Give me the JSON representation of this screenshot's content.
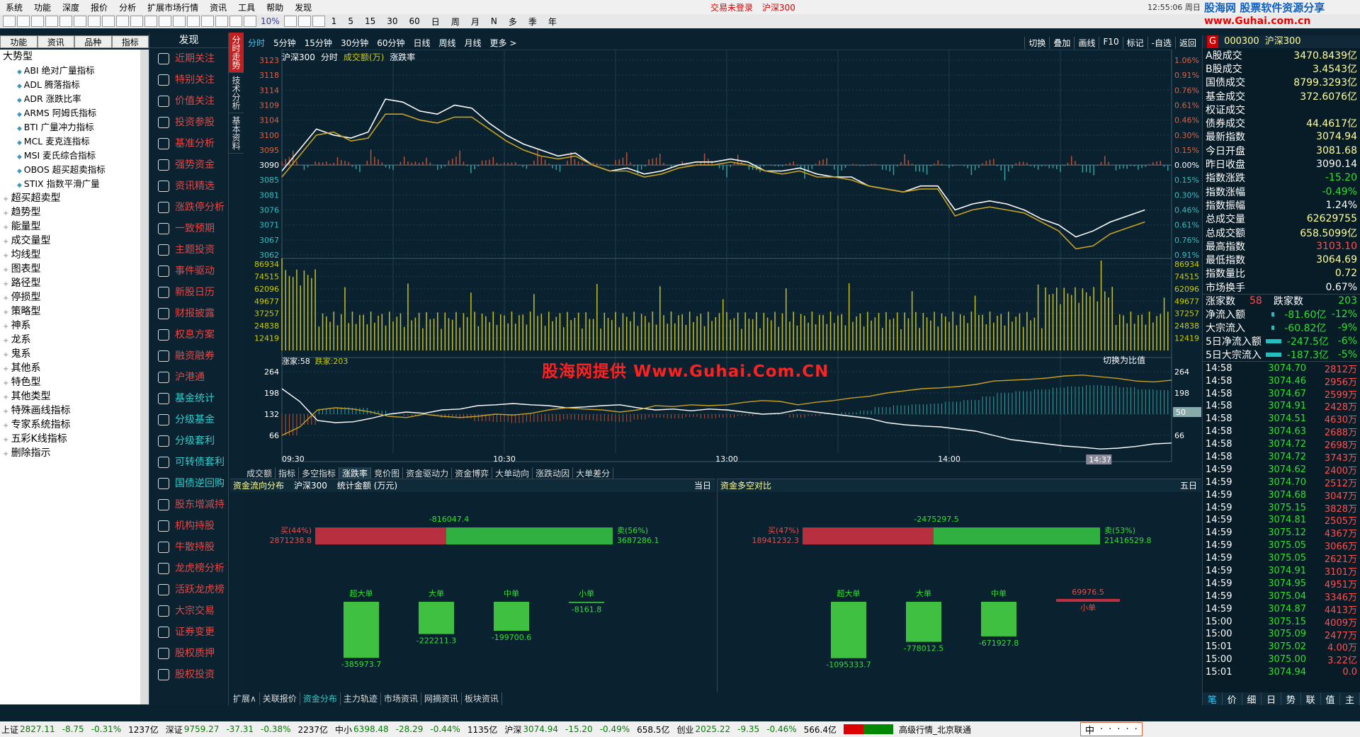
{
  "menu": {
    "items": [
      "系统",
      "功能",
      "深度",
      "报价",
      "分析",
      "扩展市场行情",
      "资讯",
      "工具",
      "帮助",
      "发现"
    ],
    "status": "交易未登录",
    "index": "沪深300",
    "clock": "12:55:06 周日",
    "watermark_top": "股海网 股票软件资源分享",
    "watermark_url": "www.Guhai.com.cn"
  },
  "toolbar": {
    "zoom": "10%",
    "periods": [
      "1",
      "5",
      "15",
      "30",
      "60",
      "日",
      "周",
      "月",
      "N",
      "多",
      "季",
      "年"
    ]
  },
  "left_tabs": [
    "功能",
    "资讯",
    "品种",
    "指标"
  ],
  "tree": {
    "root": "大势型",
    "children": [
      "ABI 绝对广量指标",
      "ADL 腾落指标",
      "ADR 涨跌比率",
      "ARMS 阿姆氏指标",
      "BTI 广量冲力指标",
      "MCL 麦克连指标",
      "MSI 麦氏综合指标",
      "OBOS 超买超卖指标",
      "STIX 指数平滑广量"
    ],
    "groups": [
      "超买超卖型",
      "趋势型",
      "能量型",
      "成交量型",
      "均线型",
      "图表型",
      "路径型",
      "停损型",
      "策略型",
      "神系",
      "龙系",
      "鬼系",
      "其他系",
      "特色型",
      "其他类型",
      "特殊画线指标",
      "专家系统指标",
      "五彩K线指标",
      "删除指示"
    ]
  },
  "discover": {
    "title": "发现",
    "items": [
      "近期关注",
      "特别关注",
      "价值关注",
      "投资参股",
      "基准分析",
      "强势资金",
      "资讯精选",
      "涨跌停分析",
      "一致预期",
      "主题投资",
      "事件驱动",
      "新股日历",
      "财报披露",
      "权息方案",
      "融资融券",
      "沪港通",
      "基金统计",
      "分级基金",
      "分级套利",
      "可转债套利",
      "国债逆回购",
      "股东增减持",
      "机构持股",
      "牛散持股",
      "龙虎榜分析",
      "活跃龙虎榜",
      "大宗交易",
      "证券变更",
      "股权质押",
      "股权投资"
    ]
  },
  "side_tabs": [
    "分时走势",
    "技术分析",
    "基本资料"
  ],
  "period_bar": {
    "items": [
      "分时",
      "5分钟",
      "15分钟",
      "30分钟",
      "60分钟",
      "日线",
      "周线",
      "月线",
      "更多 >"
    ],
    "right": [
      "切换",
      "叠加",
      "画线",
      "F10",
      "标记",
      "-自选",
      "返回"
    ]
  },
  "chart_labels": {
    "name": "沪深300",
    "mode": "分时",
    "vol_label": "成交额(万)",
    "ratio": "涨跌率",
    "up_count": "涨家:58",
    "down_count": "跌家:203",
    "switch": "切换为比值"
  },
  "watermark": "股海网提供 Www.Guhai.Com.CN",
  "chart_data": {
    "type": "line",
    "x_ticks": [
      "09:30",
      "10:30",
      "13:00",
      "14:00"
    ],
    "cursor_time": "14:37",
    "price_ticks": [
      "3123",
      "3118",
      "3114",
      "3109",
      "3104",
      "3100",
      "3095",
      "3090",
      "3085",
      "3081",
      "3076",
      "3071",
      "3067",
      "3062"
    ],
    "pct_ticks": [
      "1.06%",
      "0.91%",
      "0.76%",
      "0.61%",
      "0.46%",
      "0.30%",
      "0.15%",
      "0.00%",
      "0.15%",
      "0.30%",
      "0.46%",
      "0.61%",
      "0.76%",
      "0.91%"
    ],
    "vol_ticks": [
      "86934",
      "74515",
      "62096",
      "49677",
      "37257",
      "24838",
      "12419"
    ],
    "ratio_ticks": [
      "264",
      "198",
      "132",
      "66"
    ],
    "ratio_marker": "50",
    "prev_close": 3090.14,
    "price_range": [
      3060,
      3125
    ],
    "series": [
      {
        "name": "沪深300",
        "values": [
          3088,
          3095,
          3102,
          3100,
          3099,
          3101,
          3112,
          3111,
          3108,
          3107,
          3110,
          3109,
          3104,
          3100,
          3097,
          3095,
          3093,
          3094,
          3090,
          3088,
          3089,
          3087,
          3088,
          3090,
          3091,
          3091,
          3092,
          3091,
          3088,
          3088,
          3089,
          3087,
          3086,
          3086,
          3083,
          3082,
          3081,
          3083,
          3083,
          3075,
          3077,
          3078,
          3077,
          3075,
          3072,
          3070,
          3066,
          3068,
          3071,
          3073,
          3075
        ]
      },
      {
        "values": [
          3086,
          3093,
          3100,
          3101,
          3098,
          3099,
          3107,
          3107,
          3105,
          3104,
          3106,
          3106,
          3102,
          3098,
          3095,
          3093,
          3092,
          3093,
          3090,
          3088,
          3088,
          3086,
          3087,
          3089,
          3090,
          3090,
          3091,
          3090,
          3088,
          3087,
          3088,
          3086,
          3086,
          3085,
          3083,
          3082,
          3081,
          3082,
          3082,
          3073,
          3075,
          3076,
          3075,
          3074,
          3071,
          3068,
          3062,
          3063,
          3067,
          3069,
          3071
        ]
      }
    ],
    "ratio_series": [
      {
        "name": "涨家",
        "values": [
          90,
          120,
          165,
          170,
          168,
          160,
          150,
          145,
          148,
          140,
          138,
          130,
          128,
          125,
          128,
          130,
          135,
          133,
          130,
          128,
          135,
          140,
          138,
          142,
          138,
          140,
          145,
          150,
          148,
          140,
          145,
          150,
          155,
          160,
          170,
          175,
          178,
          180,
          185,
          190,
          200,
          210,
          215,
          220,
          225,
          228,
          232,
          230,
          226,
          220,
          218
        ]
      },
      {
        "name": "跌家",
        "values": [
          200,
          180,
          140,
          135,
          138,
          145,
          155,
          158,
          150,
          155,
          158,
          155,
          150,
          152,
          148,
          140,
          135,
          138,
          140,
          145,
          140,
          130,
          132,
          128,
          130,
          128,
          122,
          118,
          120,
          128,
          122,
          118,
          112,
          108,
          100,
          95,
          90,
          88,
          85,
          80,
          72,
          70,
          68,
          65,
          60,
          58,
          62,
          66,
          72,
          74,
          70
        ]
      }
    ]
  },
  "bottom_tabs": [
    "成交额",
    "指标",
    "多空指标",
    "涨跌率",
    "竞价图",
    "资金驱动力",
    "资金博弈",
    "大单动向",
    "涨跌动因",
    "大单差分"
  ],
  "flow_panel": {
    "title": "资金流向分布",
    "index": "沪深300",
    "unit": "统计金额 (万元)",
    "period": "当日",
    "buy_label": "买(44%)",
    "buy_value": "2871238.8",
    "net": "-816047.4",
    "sell_label": "卖(56%)",
    "sell_value": "3687286.1",
    "bars": [
      {
        "name": "超大单",
        "value": "-385973.7"
      },
      {
        "name": "大单",
        "value": "-222211.3"
      },
      {
        "name": "中单",
        "value": "-199700.6"
      },
      {
        "name": "小单",
        "value": "-8161.8"
      }
    ]
  },
  "multi_panel": {
    "title": "资金多空对比",
    "period": "五日",
    "buy_label": "买(47%)",
    "buy_value": "18941232.3",
    "net": "-2475297.5",
    "sell_label": "卖(53%)",
    "sell_value": "21416529.8",
    "bars": [
      {
        "name": "超大单",
        "value": "-1095333.7"
      },
      {
        "name": "大单",
        "value": "-778012.5"
      },
      {
        "name": "中单",
        "value": "-671927.8"
      },
      {
        "name": "小单",
        "value": "69976.5"
      }
    ]
  },
  "bottom_tabs2": [
    "扩展∧",
    "关联报价",
    "资金分布",
    "主力轨迹",
    "市场资讯",
    "网摘资讯",
    "板块资讯"
  ],
  "right": {
    "code": "000300",
    "name": "沪深300",
    "stats": [
      {
        "k": "A股成交",
        "v": "3470.8439亿"
      },
      {
        "k": "B股成交",
        "v": "3.4543亿"
      },
      {
        "k": "国债成交",
        "v": "8799.3293亿"
      },
      {
        "k": "基金成交",
        "v": "372.6076亿"
      },
      {
        "k": "权证成交",
        "v": ""
      },
      {
        "k": "债券成交",
        "v": "44.4617亿"
      },
      {
        "k": "最新指数",
        "v": "3074.94"
      },
      {
        "k": "今日开盘",
        "v": "3081.68"
      },
      {
        "k": "昨日收盘",
        "v": "3090.14"
      },
      {
        "k": "指数涨跌",
        "v": "-15.20"
      },
      {
        "k": "指数涨幅",
        "v": "-0.49%"
      },
      {
        "k": "指数振幅",
        "v": "1.24%"
      },
      {
        "k": "总成交量",
        "v": "62629755"
      },
      {
        "k": "总成交额",
        "v": "658.5099亿"
      },
      {
        "k": "最高指数",
        "v": "3103.10"
      },
      {
        "k": "最低指数",
        "v": "3064.69"
      },
      {
        "k": "指数量比",
        "v": "0.72"
      },
      {
        "k": "市场换手",
        "v": "0.67%"
      }
    ],
    "up_label": "涨家数",
    "up_val": "58",
    "down_label": "跌家数",
    "down_val": "203",
    "flows": [
      {
        "k": "净流入额",
        "v": "-81.60亿",
        "p": "-12%",
        "w": 0.1
      },
      {
        "k": "大宗流入",
        "v": "-60.82亿",
        "p": "-9%",
        "w": 0.1
      },
      {
        "k": "5日净流入额",
        "v": "-247.5亿",
        "p": "-6%",
        "w": 0.6
      },
      {
        "k": "5日大宗流入",
        "v": "-187.3亿",
        "p": "-5%",
        "w": 0.6
      }
    ],
    "ticks": [
      [
        "14:58",
        "3074.70",
        "2812万"
      ],
      [
        "14:58",
        "3074.46",
        "2956万"
      ],
      [
        "14:58",
        "3074.67",
        "2599万"
      ],
      [
        "14:58",
        "3074.91",
        "2428万"
      ],
      [
        "14:58",
        "3074.51",
        "4630万"
      ],
      [
        "14:58",
        "3074.63",
        "2688万"
      ],
      [
        "14:58",
        "3074.72",
        "2698万"
      ],
      [
        "14:58",
        "3074.72",
        "3743万"
      ],
      [
        "14:59",
        "3074.62",
        "2400万"
      ],
      [
        "14:59",
        "3074.70",
        "2512万"
      ],
      [
        "14:59",
        "3074.68",
        "3047万"
      ],
      [
        "14:59",
        "3075.15",
        "3828万"
      ],
      [
        "14:59",
        "3074.81",
        "2505万"
      ],
      [
        "14:59",
        "3075.12",
        "4367万"
      ],
      [
        "14:59",
        "3075.05",
        "3066万"
      ],
      [
        "14:59",
        "3075.05",
        "2621万"
      ],
      [
        "14:59",
        "3074.91",
        "3101万"
      ],
      [
        "14:59",
        "3074.95",
        "4951万"
      ],
      [
        "14:59",
        "3075.04",
        "3346万"
      ],
      [
        "14:59",
        "3074.87",
        "4413万"
      ],
      [
        "15:00",
        "3075.15",
        "4009万"
      ],
      [
        "15:00",
        "3075.09",
        "2477万"
      ],
      [
        "15:01",
        "3075.02",
        "4.00万"
      ],
      [
        "15:00",
        "3075.00",
        "3.22亿"
      ],
      [
        "15:01",
        "3074.94",
        "0.0"
      ]
    ],
    "tabs": [
      "笔",
      "价",
      "细",
      "日",
      "势",
      "联",
      "值",
      "主"
    ]
  },
  "statusbar": [
    {
      "n": "上证",
      "v": "2827.11",
      "c": "-8.75",
      "p": "-0.31%",
      "a": "1237亿"
    },
    {
      "n": "深证",
      "v": "9759.27",
      "c": "-37.31",
      "p": "-0.38%",
      "a": "2237亿"
    },
    {
      "n": "中小",
      "v": "6398.48",
      "c": "-28.29",
      "p": "-0.44%",
      "a": "1135亿"
    },
    {
      "n": "沪深",
      "v": "3074.94",
      "c": "-15.20",
      "p": "-0.49%",
      "a": "658.5亿"
    },
    {
      "n": "创业",
      "v": "2025.22",
      "c": "-9.35",
      "p": "-0.46%",
      "a": "566.4亿"
    }
  ],
  "status_server": "高级行情_北京联通",
  "ime": "中"
}
